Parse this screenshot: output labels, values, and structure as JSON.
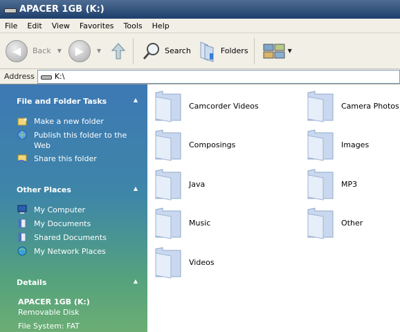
{
  "window": {
    "title": "APACER 1GB (K:)"
  },
  "menu": [
    "File",
    "Edit",
    "View",
    "Favorites",
    "Tools",
    "Help"
  ],
  "toolbar": {
    "back": "Back",
    "search": "Search",
    "folders": "Folders"
  },
  "address": {
    "label": "Address",
    "value": "K:\\"
  },
  "sidebar": {
    "file_tasks": {
      "title": "File and Folder Tasks",
      "items": [
        "Make a new folder",
        "Publish this folder to the Web",
        "Share this folder"
      ]
    },
    "other_places": {
      "title": "Other Places",
      "items": [
        "My Computer",
        "My Documents",
        "Shared Documents",
        "My Network Places"
      ]
    },
    "details": {
      "title": "Details",
      "name": "APACER 1GB (K:)",
      "type": "Removable Disk",
      "filesystem": "File System: FAT"
    }
  },
  "folders": [
    "Camcorder Videos",
    "Camera Photos",
    "Composings",
    "Images",
    "Java",
    "MP3",
    "Music",
    "Other",
    "Videos"
  ]
}
